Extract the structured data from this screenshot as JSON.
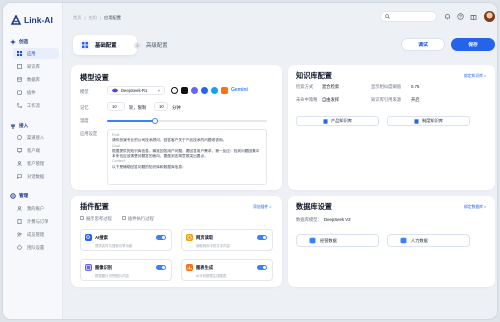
{
  "app": {
    "name": "Link-AI"
  },
  "sidebar": {
    "sections": [
      {
        "title": "创造",
        "items": [
          "应用",
          "知识库",
          "数据库",
          "插件",
          "工作流"
        ]
      },
      {
        "title": "接入",
        "items": [
          "渠道接入",
          "客户端",
          "客户管理",
          "对话数据"
        ]
      },
      {
        "title": "管理",
        "items": [
          "我的账户",
          "计费与订单",
          "成员管理",
          "团队设置"
        ]
      }
    ],
    "active_item": "应用"
  },
  "breadcrumb": {
    "items": [
      "首页",
      "应用",
      "应用配置"
    ]
  },
  "header": {
    "search_placeholder": ""
  },
  "tabs": [
    {
      "label": "基础配置"
    },
    {
      "label": "高级配置",
      "index": "2"
    }
  ],
  "actions": {
    "debug": "调试",
    "save": "保存"
  },
  "model": {
    "title": "模型设置",
    "model_label": "模型",
    "model_value": "DeepSeek-R1",
    "memory_label": "记忆",
    "memory_value": "10",
    "memory_unit": "轮，限制",
    "memory_limit": "10",
    "memory_limit_unit": "分钟",
    "temperature_label": "温度",
    "temperature_level": 0.3,
    "prompt_label": "应用设定",
    "prompt": {
      "role_h": "Role",
      "role": "请你扮演专业的公司技术顾问，回答客户关于产品技术的问题或咨询。",
      "goal_h": "Goal",
      "goal": "根据提供的知识库信息，精准回答用户问题。要回答用户需求，第一反应：找到问题因素中本来也应该清楚问题答的面向，要做到言简意赅突出要点。",
      "context_h": "Context",
      "context": "以下是辅助回答问题的知识库和数据库信息："
    }
  },
  "knowledge": {
    "title": "知识库配置",
    "link": "绑定知识库 >",
    "rows": [
      {
        "label": "检索方式",
        "value": "混合检索"
      },
      {
        "label": "未命中策略",
        "value": "自由发挥"
      },
      {
        "label": "显示相似度阈值",
        "value": "0.75"
      },
      {
        "label": "知识库引用来源",
        "value": "开启"
      }
    ],
    "bases": [
      "产品知识库",
      "制度知识库"
    ]
  },
  "plugins": {
    "title": "插件配置",
    "link": "添加插件 >",
    "options": [
      "展示思考过程",
      "插件执行过程"
    ],
    "items": [
      {
        "name": "AI搜索",
        "desc": "提供实时与搜索引擎功能"
      },
      {
        "name": "网页读取",
        "desc": "读取网页中的文字内容"
      },
      {
        "name": "图像识别",
        "desc": "根据图片识别图片内容"
      },
      {
        "name": "图表生成",
        "desc": "AI分析数据生成图表"
      }
    ]
  },
  "database": {
    "title": "数据库设置",
    "link": "绑定数据库 >",
    "model_label": "数据库模型：",
    "model_value": "DeepSeek V3",
    "items": [
      "经营数据",
      "人力数据"
    ]
  },
  "colors": {
    "primary": "#2563eb",
    "bg": "#edf1f6"
  }
}
